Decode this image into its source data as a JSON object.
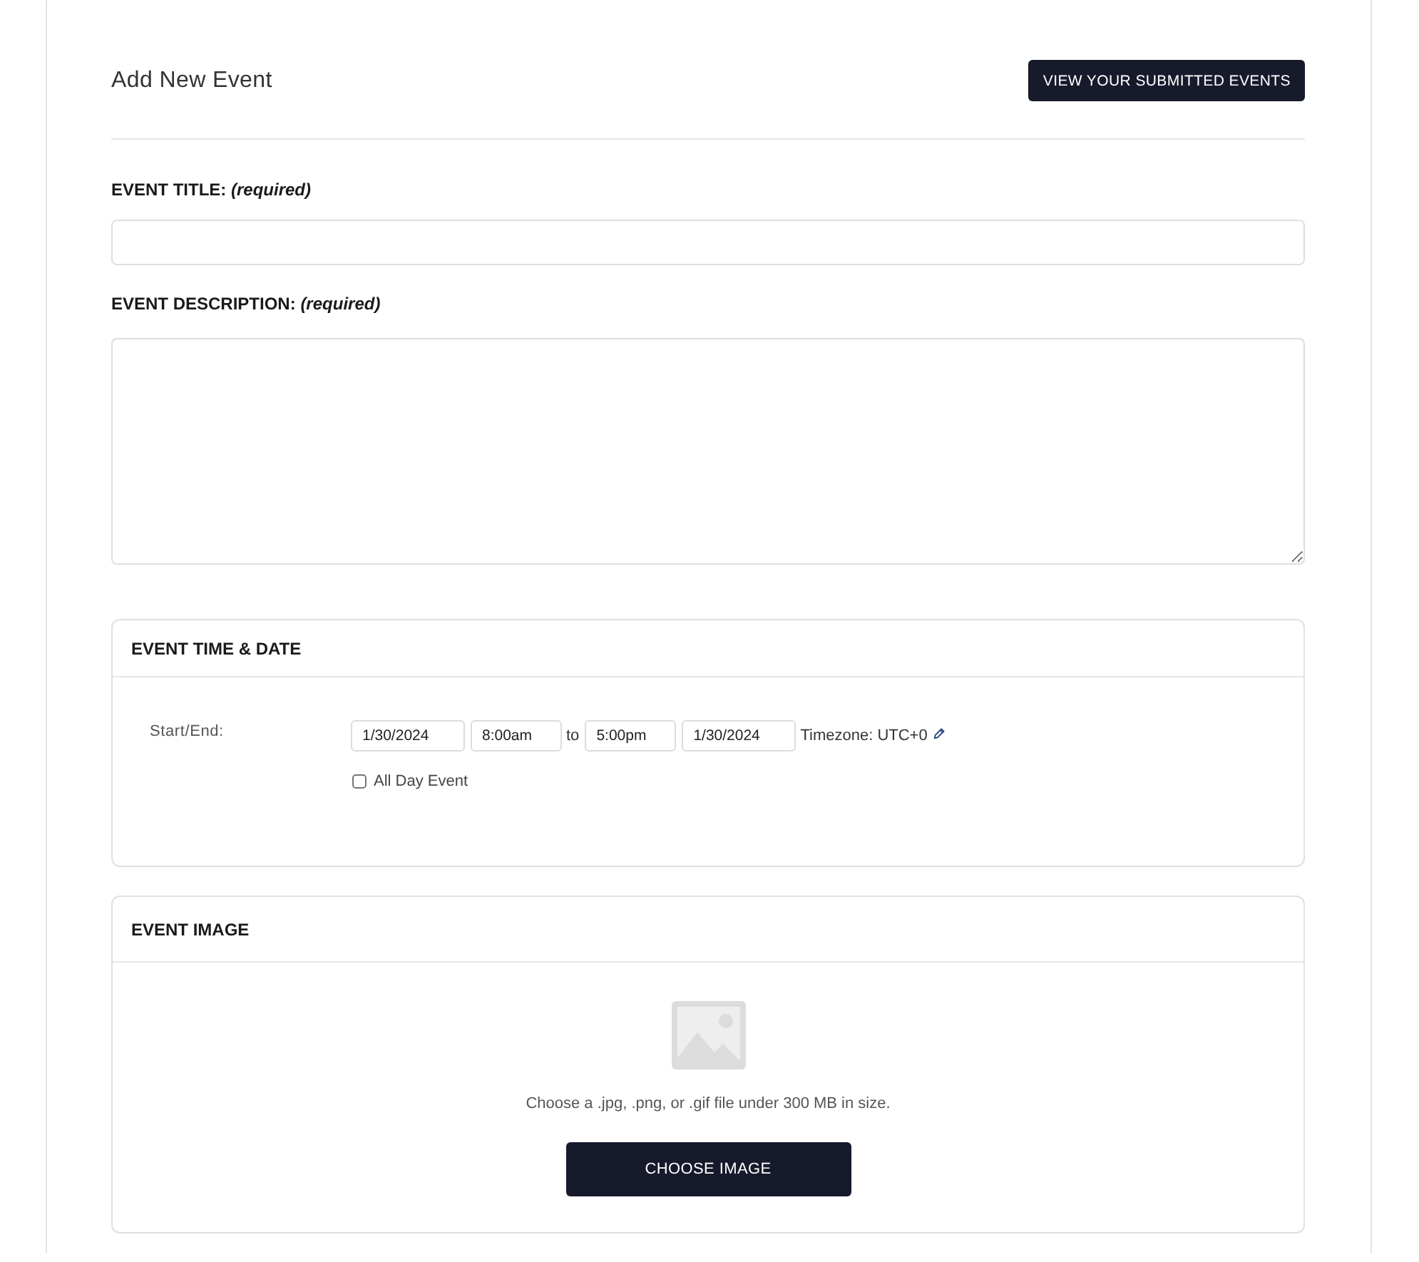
{
  "header": {
    "title": "Add New Event",
    "button": "VIEW YOUR SUBMITTED EVENTS"
  },
  "fields": [
    {
      "kind": "input",
      "label": "EVENT TITLE: *(required)*"
    },
    {
      "kind": "textarea",
      "label": "EVENT DESCRIPTION: *(required)*"
    }
  ],
  "time_section": {
    "title": "EVENT TIME & DATE",
    "row_label": "Start/End:",
    "controls": [
      {
        "kind": "date",
        "value": "1/30/2024"
      },
      {
        "kind": "time",
        "value": "8:00am"
      },
      {
        "kind": "text",
        "text": "to"
      },
      {
        "kind": "time",
        "value": "5:00pm"
      },
      {
        "kind": "date",
        "value": "1/30/2024"
      },
      {
        "kind": "timezone",
        "text": "Timezone: UTC+0"
      }
    ],
    "all_day": {
      "label": "All Day Event",
      "checked": false
    }
  },
  "image_section": {
    "title": "EVENT IMAGE",
    "hint": "Choose a .jpg, .png, or .gif file under 300 MB in size.",
    "button": "CHOOSE IMAGE"
  }
}
